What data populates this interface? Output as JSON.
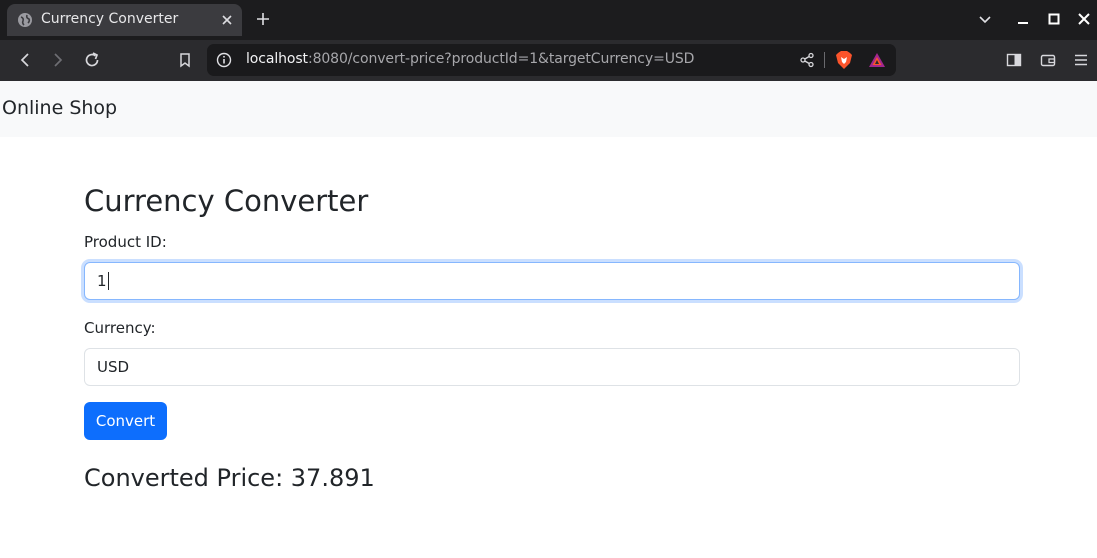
{
  "browser": {
    "tab_title": "Currency Converter",
    "url_host": "localhost",
    "url_rest": ":8080/convert-price?productId=1&targetCurrency=USD"
  },
  "icons": {
    "tab_favicon": "globe-icon",
    "tab_close": "close-icon",
    "new_tab": "plus-icon",
    "back": "arrow-left-icon",
    "forward": "arrow-right-icon",
    "reload": "reload-icon",
    "bookmark": "bookmark-icon",
    "site_info": "info-icon",
    "share": "share-icon",
    "brave_shields": "brave-shield-icon",
    "rewards": "rewards-triangle-icon",
    "sidebar": "sidebar-icon",
    "wallet": "wallet-icon",
    "menu": "hamburger-menu-icon"
  },
  "navbar": {
    "brand": "Online Shop"
  },
  "form": {
    "title": "Currency Converter",
    "product_label": "Product ID:",
    "product_value": "1",
    "currency_label": "Currency:",
    "currency_value": "USD",
    "convert_label": "Convert"
  },
  "result": {
    "text": "Converted Price: 37.891"
  },
  "colors": {
    "primary": "#0d6efd",
    "navbar_bg": "#f8f9fa",
    "focus_border": "#86b7fe"
  }
}
